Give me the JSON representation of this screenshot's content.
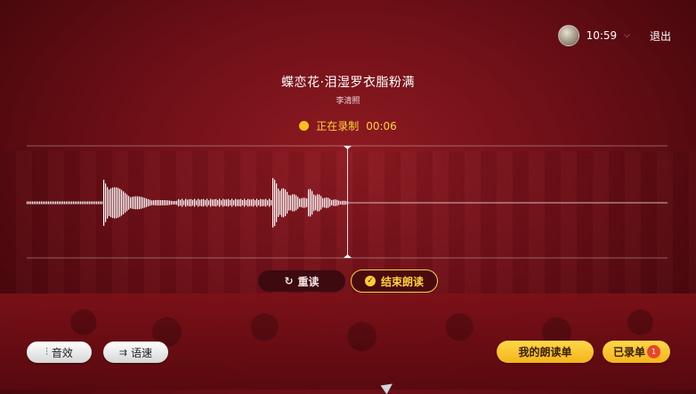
{
  "header": {
    "time": "10:59",
    "exit_label": "退出",
    "avatar_icon": "user-avatar-icon",
    "chevron_icon": "chevron-down-icon"
  },
  "poem": {
    "title": "蝶恋花·泪湿罗衣脂粉满",
    "author": "李清照"
  },
  "recording": {
    "status_label": "正在录制",
    "elapsed": "00:06",
    "indicator_color": "#ffc01e"
  },
  "controls": {
    "reread_label": "重读",
    "reread_icon": "refresh-icon",
    "finish_label": "结束朗读",
    "finish_icon": "check-circle-icon"
  },
  "footer": {
    "effect_label": "音效",
    "effect_icon": "equalizer-icon",
    "speed_label": "语速",
    "speed_icon": "speed-icon",
    "my_list_label": "我的朗读单",
    "recorded_label": "已录单",
    "recorded_count": "1"
  },
  "colors": {
    "accent": "#ffce3a",
    "background": "#8e1a22",
    "badge": "#e8452a"
  }
}
